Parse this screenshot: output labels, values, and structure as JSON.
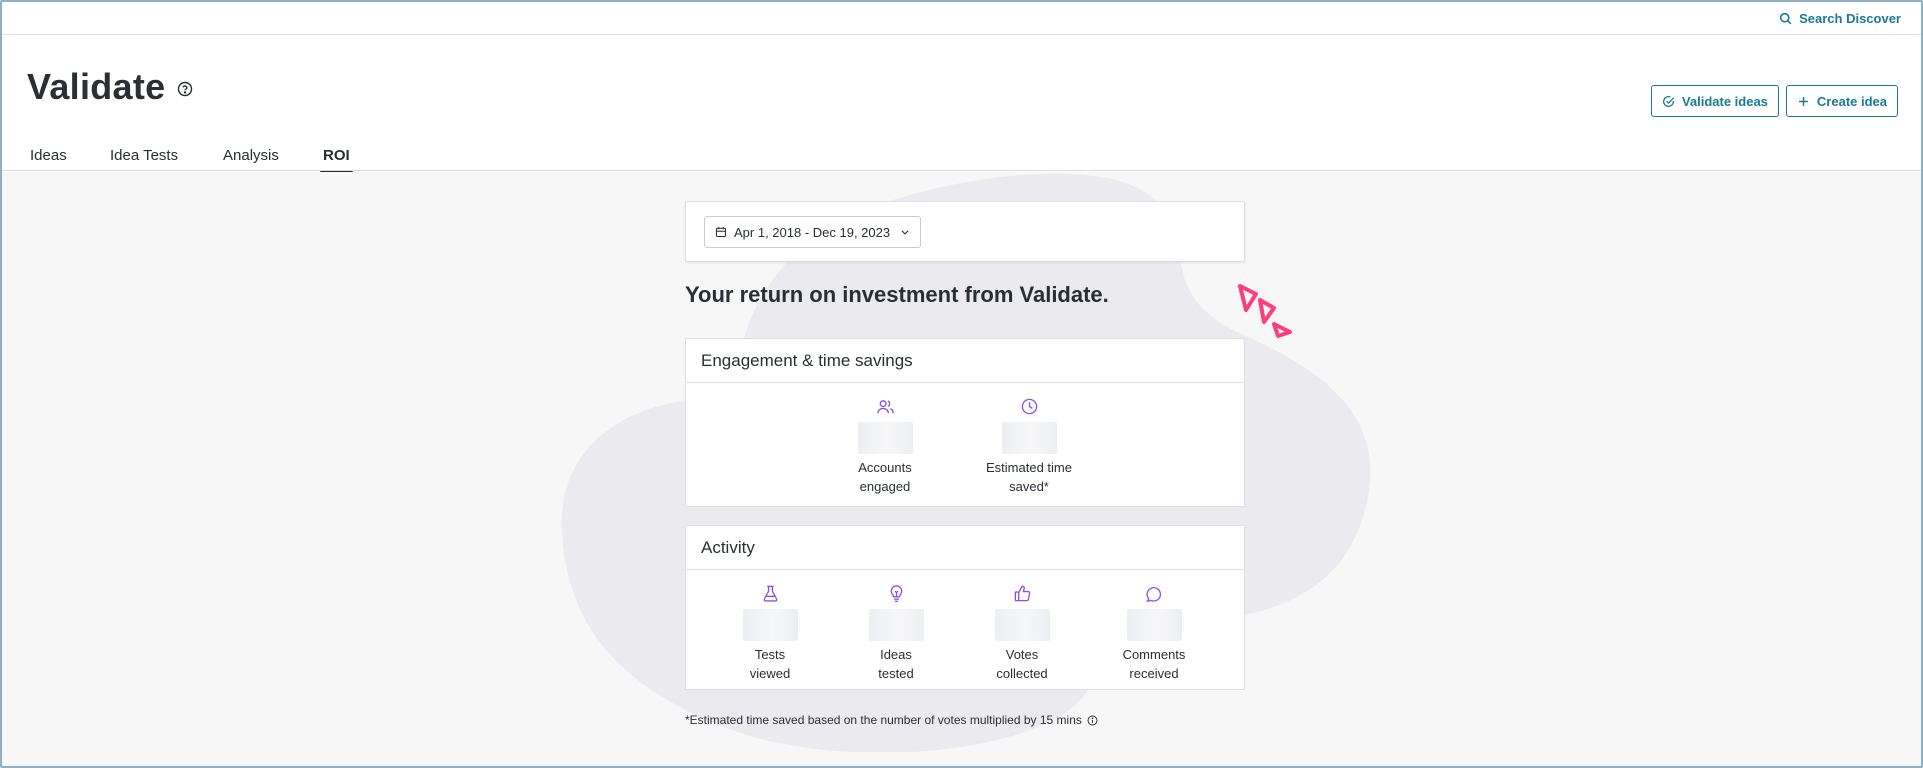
{
  "topbar": {
    "search_label": "Search Discover"
  },
  "header": {
    "title": "Validate",
    "validate_button": "Validate ideas",
    "create_button": "Create idea"
  },
  "tabs": [
    {
      "label": "Ideas",
      "active": false
    },
    {
      "label": "Idea Tests",
      "active": false
    },
    {
      "label": "Analysis",
      "active": false
    },
    {
      "label": "ROI",
      "active": true
    }
  ],
  "filters": {
    "date_range": "Apr 1, 2018 - Dec 19, 2023"
  },
  "main": {
    "headline": "Your return on investment from Validate.",
    "engagement": {
      "title": "Engagement & time savings",
      "metrics": [
        {
          "icon": "users-icon",
          "label": "Accounts\nengaged"
        },
        {
          "icon": "clock-icon",
          "label": "Estimated time\nsaved*"
        }
      ]
    },
    "activity": {
      "title": "Activity",
      "metrics": [
        {
          "icon": "flask-icon",
          "label": "Tests\nviewed"
        },
        {
          "icon": "lightbulb-icon",
          "label": "Ideas\ntested"
        },
        {
          "icon": "thumbs-up-icon",
          "label": "Votes\ncollected"
        },
        {
          "icon": "comment-icon",
          "label": "Comments\nreceived"
        }
      ]
    },
    "footnote": "*Estimated time saved based on the number of votes multiplied by 15 mins"
  },
  "colors": {
    "accent": "#1a7a96",
    "icon_purple": "#8a52e0",
    "decor_pink": "#ff3d7a",
    "blob": "#ebebef"
  }
}
